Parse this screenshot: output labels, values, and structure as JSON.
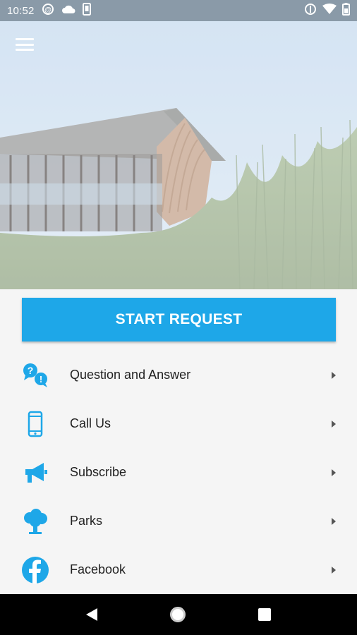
{
  "status_bar": {
    "time": "10:52",
    "left_icons": [
      "sync-icon",
      "cloud-icon",
      "phone-icon"
    ],
    "right_icons": [
      "data-saver-icon",
      "wifi-icon",
      "battery-icon"
    ]
  },
  "header": {
    "menu_icon": "hamburger-menu-icon"
  },
  "main": {
    "start_request_label": "START REQUEST",
    "items": [
      {
        "label": "Question and Answer",
        "icon": "question-answer-icon"
      },
      {
        "label": "Call Us",
        "icon": "phone-icon"
      },
      {
        "label": "Subscribe",
        "icon": "megaphone-icon"
      },
      {
        "label": "Parks",
        "icon": "tree-icon"
      },
      {
        "label": "Facebook",
        "icon": "facebook-icon"
      }
    ]
  },
  "colors": {
    "accent": "#1ea7e8",
    "status_bar": "#8a9aa8",
    "background": "#f5f5f5",
    "nav_bar": "#000000"
  }
}
